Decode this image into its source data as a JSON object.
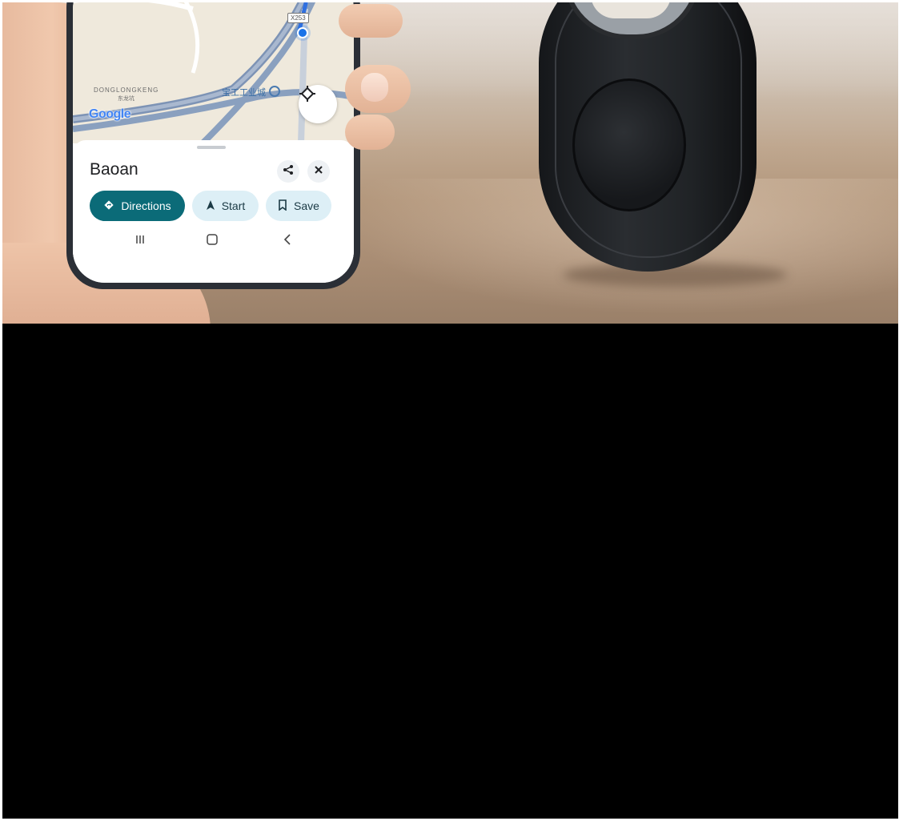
{
  "phone": {
    "map": {
      "area_label": "DONGLONGKENG",
      "area_label_sub": "东龙坑",
      "poi_label": "宝工工业城",
      "road_shield": "X253",
      "logo_text": "Google"
    },
    "place_sheet": {
      "title": "Baoan",
      "actions": {
        "directions_label": "Directions",
        "start_label": "Start",
        "save_label": "Save"
      }
    }
  },
  "colors": {
    "directions_chip": "#0b6b78",
    "secondary_chip": "#ddeff6",
    "location_dot": "#1a73e8",
    "bottom_area": "#000000"
  }
}
